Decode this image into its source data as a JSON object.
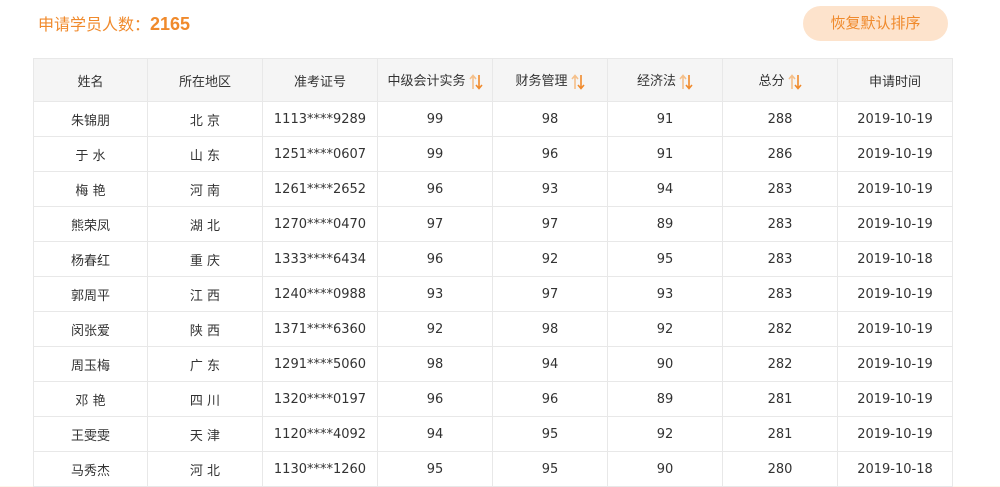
{
  "header": {
    "count_label": "申请学员人数：",
    "count_value": "2165",
    "reset_button": "恢复默认排序"
  },
  "table": {
    "columns": [
      "姓名",
      "所在地区",
      "准考证号",
      "中级会计实务",
      "财务管理",
      "经济法",
      "总分",
      "申请时间"
    ],
    "rows": [
      [
        "朱锦朋",
        "北 京",
        "1113****9289",
        "99",
        "98",
        "91",
        "288",
        "2019-10-19"
      ],
      [
        "于 水",
        "山 东",
        "1251****0607",
        "99",
        "96",
        "91",
        "286",
        "2019-10-19"
      ],
      [
        "梅 艳",
        "河 南",
        "1261****2652",
        "96",
        "93",
        "94",
        "283",
        "2019-10-19"
      ],
      [
        "熊荣凤",
        "湖 北",
        "1270****0470",
        "97",
        "97",
        "89",
        "283",
        "2019-10-19"
      ],
      [
        "杨春红",
        "重 庆",
        "1333****6434",
        "96",
        "92",
        "95",
        "283",
        "2019-10-18"
      ],
      [
        "郭周平",
        "江 西",
        "1240****0988",
        "93",
        "97",
        "93",
        "283",
        "2019-10-19"
      ],
      [
        "闵张爱",
        "陕 西",
        "1371****6360",
        "92",
        "98",
        "92",
        "282",
        "2019-10-19"
      ],
      [
        "周玉梅",
        "广 东",
        "1291****5060",
        "98",
        "94",
        "90",
        "282",
        "2019-10-19"
      ],
      [
        "邓 艳",
        "四 川",
        "1320****0197",
        "96",
        "96",
        "89",
        "281",
        "2019-10-19"
      ],
      [
        "王雯雯",
        "天 津",
        "1120****4092",
        "94",
        "95",
        "92",
        "281",
        "2019-10-19"
      ],
      [
        "马秀杰",
        "河 北",
        "1130****1260",
        "95",
        "95",
        "90",
        "280",
        "2019-10-18"
      ]
    ]
  },
  "icons": {
    "sort": "sort-arrows-icon"
  },
  "colors": {
    "accent": "#f08a2c",
    "button_bg": "#fde3cc",
    "header_bg": "#f5f5f5",
    "border": "#e8e8e8"
  }
}
